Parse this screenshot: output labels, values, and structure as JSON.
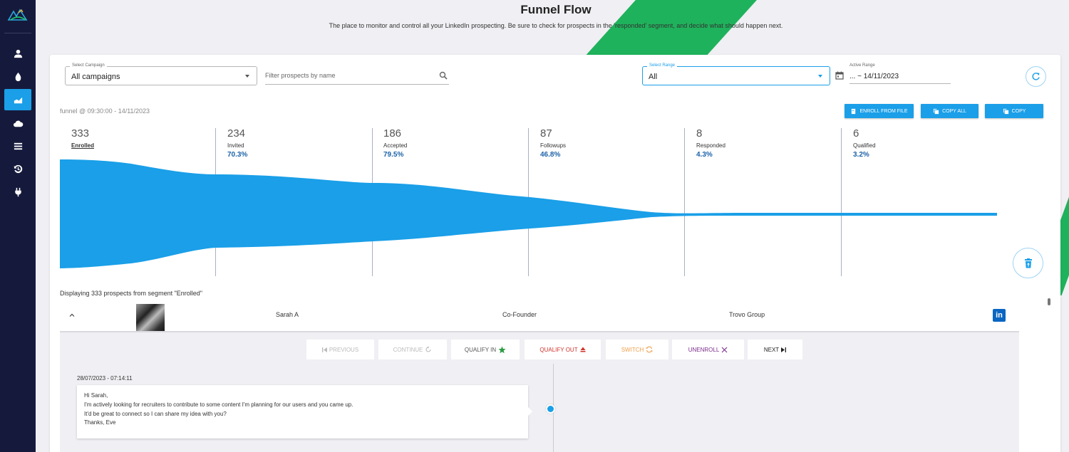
{
  "header": {
    "title": "Funnel Flow",
    "subtitle": "The place to monitor and control all your LinkedIn prospecting. Be sure to check for prospects in the 'responded' segment, and decide what should happen next."
  },
  "sidebar": {
    "items": [
      {
        "icon": "person-icon",
        "active": false
      },
      {
        "icon": "drop-icon",
        "active": false
      },
      {
        "icon": "funnel-chart-icon",
        "active": true
      },
      {
        "icon": "cloud-icon",
        "active": false
      },
      {
        "icon": "list-icon",
        "active": false
      },
      {
        "icon": "history-icon",
        "active": false
      },
      {
        "icon": "plug-icon",
        "active": false
      }
    ]
  },
  "filters": {
    "campaign": {
      "label": "Select Campaign",
      "value": "All campaigns"
    },
    "search": {
      "placeholder": "Filter prospects by name",
      "value": ""
    },
    "range": {
      "label": "Select Range",
      "value": "All"
    },
    "active_range": {
      "label": "Active Range",
      "value": "... ~ 14/11/2023"
    }
  },
  "funnel": {
    "caption": "funnel @ 09:30:00 - 14/11/2023",
    "stages": [
      {
        "count": "333",
        "name": "Enrolled",
        "pct": ""
      },
      {
        "count": "234",
        "name": "Invited",
        "pct": "70.3%"
      },
      {
        "count": "186",
        "name": "Accepted",
        "pct": "79.5%"
      },
      {
        "count": "87",
        "name": "Followups",
        "pct": "46.8%"
      },
      {
        "count": "8",
        "name": "Responded",
        "pct": "4.3%"
      },
      {
        "count": "6",
        "name": "Qualified",
        "pct": "3.2%"
      }
    ],
    "selected_stage": "Enrolled",
    "color": "#1a9fe8"
  },
  "actions": {
    "enroll_from_file": "ENROLL FROM FILE",
    "copy_all": "COPY ALL",
    "copy": "COPY"
  },
  "segment_caption": "Displaying 333 prospects from segment \"Enrolled\"",
  "prospect": {
    "name": "Sarah A",
    "title": "Co-Founder",
    "company": "Trovo Group",
    "linkedin_glyph": "in"
  },
  "step_buttons": {
    "previous": "PREVIOUS",
    "continue": "CONTINUE",
    "qualify_in": "QUALIFY IN",
    "qualify_out": "QUALIFY OUT",
    "switch": "SWITCH",
    "unenroll": "UNENROLL",
    "next": "NEXT"
  },
  "message": {
    "timestamp": "28/07/2023 - 07:14:11",
    "lines": [
      "Hi Sarah,",
      "I'm actively looking for recruiters to contribute to some content I'm planning for our users and you came up.",
      "It'd be great to connect so I can share my idea with you?",
      "Thanks, Eve"
    ]
  }
}
